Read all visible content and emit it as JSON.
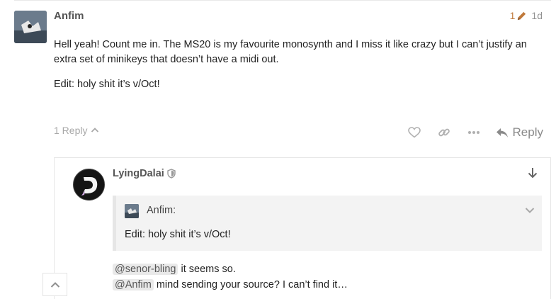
{
  "main_post": {
    "username": "Anfim",
    "edit_count": "1",
    "age": "1d",
    "paragraphs": [
      "Hell yeah! Count me in. The MS20 is my favourite monosynth and I miss it like crazy but I can’t justify an extra set of minikeys that doesn’t have a midi out.",
      "Edit: holy shit it’s v/Oct!"
    ],
    "replies_label": "1 Reply",
    "reply_button_label": "Reply"
  },
  "embedded_reply": {
    "username": "LyingDalai",
    "quote": {
      "author": "Anfim:",
      "text": "Edit: holy shit it’s v/Oct!"
    },
    "lines": [
      {
        "mention": "@senor-bling",
        "text": " it seems so."
      },
      {
        "mention": "@Anfim",
        "text": " mind sending your source? I can’t find it…"
      }
    ]
  },
  "icons": {
    "edit": "pencil-icon",
    "expand_replies": "chevron-up-icon",
    "like": "heart-icon",
    "link": "link-icon",
    "more": "ellipsis-icon",
    "reply": "reply-arrow-icon",
    "moderator": "shield-icon",
    "jump_to_post": "arrow-down-icon",
    "collapse_quote": "chevron-down-icon",
    "scroll_top": "chevron-up-icon"
  },
  "colors": {
    "text": "#222222",
    "muted": "#919191",
    "edit_accent": "#c0793a",
    "quote_bg": "#f3f3f3",
    "mention_bg": "#e9e9e9"
  }
}
